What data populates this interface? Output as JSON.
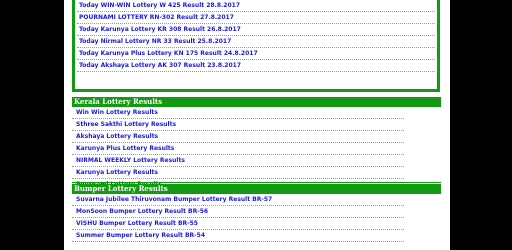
{
  "results_box": {
    "items": [
      "Today WIN-WIN Lottery W 425 Result 28.8.2017",
      "POURNAMI LOTTERY RN-302 Result 27.8.2017",
      "Today Karunya Lottery KR 308 Result 26.8.2017",
      "Today Nirmal Lottery NR 33 Result 25.8.2017",
      "Today Karunya Plus Lottery KN 175 Result 24.8.2017",
      "Today Akshaya Lottery AK 307 Result 23.8.2017"
    ]
  },
  "kerala_section": {
    "title": "Kerala Lottery Results",
    "items": [
      "Win Win Lottery Results",
      "Sthree Sakthi Lottery Results",
      "Akshaya Lottery Results",
      "Karunya Plus Lottery Results",
      "NIRMAL WEEKLY Lottery Results",
      "Karunya Lottery Results",
      "Pournami Lottery Results"
    ]
  },
  "bumper_section": {
    "title": "Bumper Lottery Results",
    "items": [
      "Suvarna Jubilee Thiruvonam Bumper Lottery Result BR-57",
      "MonSoon Bumper Lottery Result BR-56",
      "VISHU Bumper Lottery Result BR-55",
      "Summer Bumper Lottery Result BR-54"
    ]
  },
  "colors": {
    "accent_green": "#139a13",
    "link_blue": "#1a1ad6",
    "background": "#000000"
  }
}
